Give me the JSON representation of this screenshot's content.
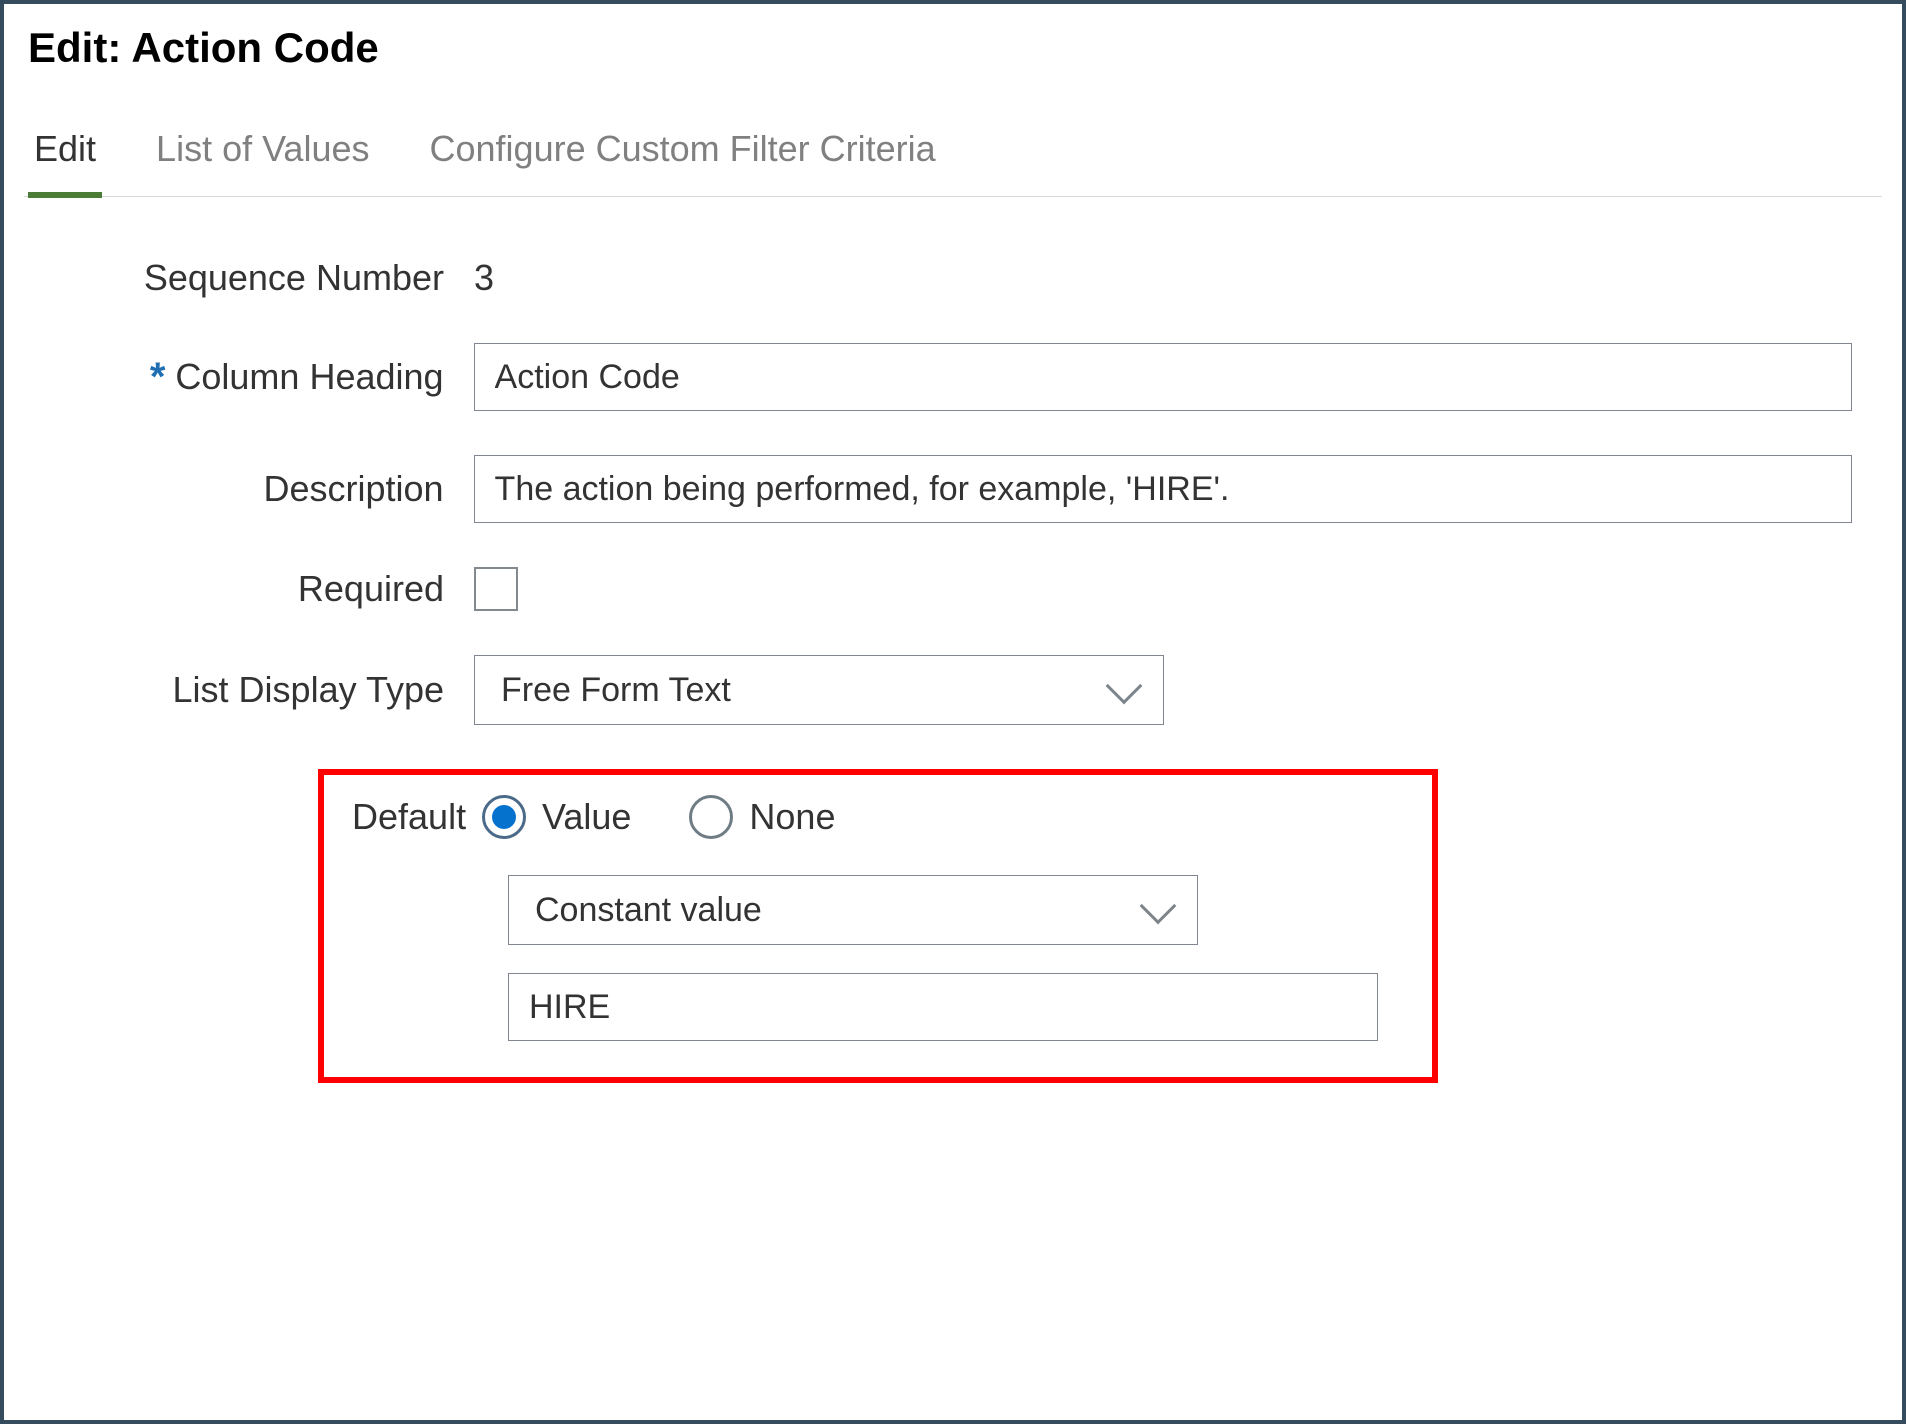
{
  "title": "Edit: Action Code",
  "tabs": [
    {
      "label": "Edit",
      "active": true
    },
    {
      "label": "List of Values",
      "active": false
    },
    {
      "label": "Configure Custom Filter Criteria",
      "active": false
    }
  ],
  "form": {
    "sequence_number_label": "Sequence Number",
    "sequence_number_value": "3",
    "column_heading_label": "Column Heading",
    "column_heading_value": "Action Code",
    "description_label": "Description",
    "description_value": "The action being performed, for example, 'HIRE'.",
    "required_label": "Required",
    "required_checked": false,
    "list_display_type_label": "List Display Type",
    "list_display_type_value": "Free Form Text",
    "default_label": "Default",
    "default_radio": {
      "value_label": "Value",
      "none_label": "None",
      "selected": "value"
    },
    "default_type_value": "Constant value",
    "default_value": "HIRE"
  }
}
